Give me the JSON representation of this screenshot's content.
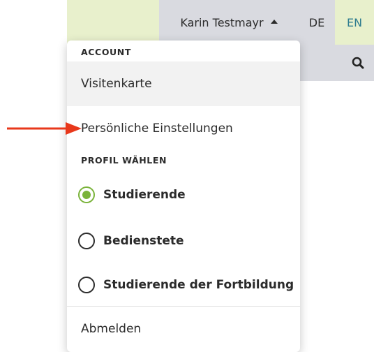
{
  "header": {
    "user_name": "Karin Testmayr",
    "lang_de": "DE",
    "lang_en": "EN",
    "accent_green": "#e8f0cc",
    "active_lang_color": "#2e7c8f"
  },
  "menu": {
    "account_heading": "ACCOUNT",
    "items": [
      {
        "label": "Visitenkarte"
      },
      {
        "label": "Persönliche Einstellungen"
      }
    ],
    "profile_heading": "PROFIL WÄHLEN",
    "profiles": [
      {
        "label": "Studierende",
        "selected": true
      },
      {
        "label": "Bedienstete",
        "selected": false
      },
      {
        "label": "Studierende der Fortbildung",
        "selected": false
      }
    ],
    "logout": "Abmelden",
    "radio_selected_color": "#7ab33a"
  },
  "annotation": {
    "arrow_color": "#e8381b"
  }
}
